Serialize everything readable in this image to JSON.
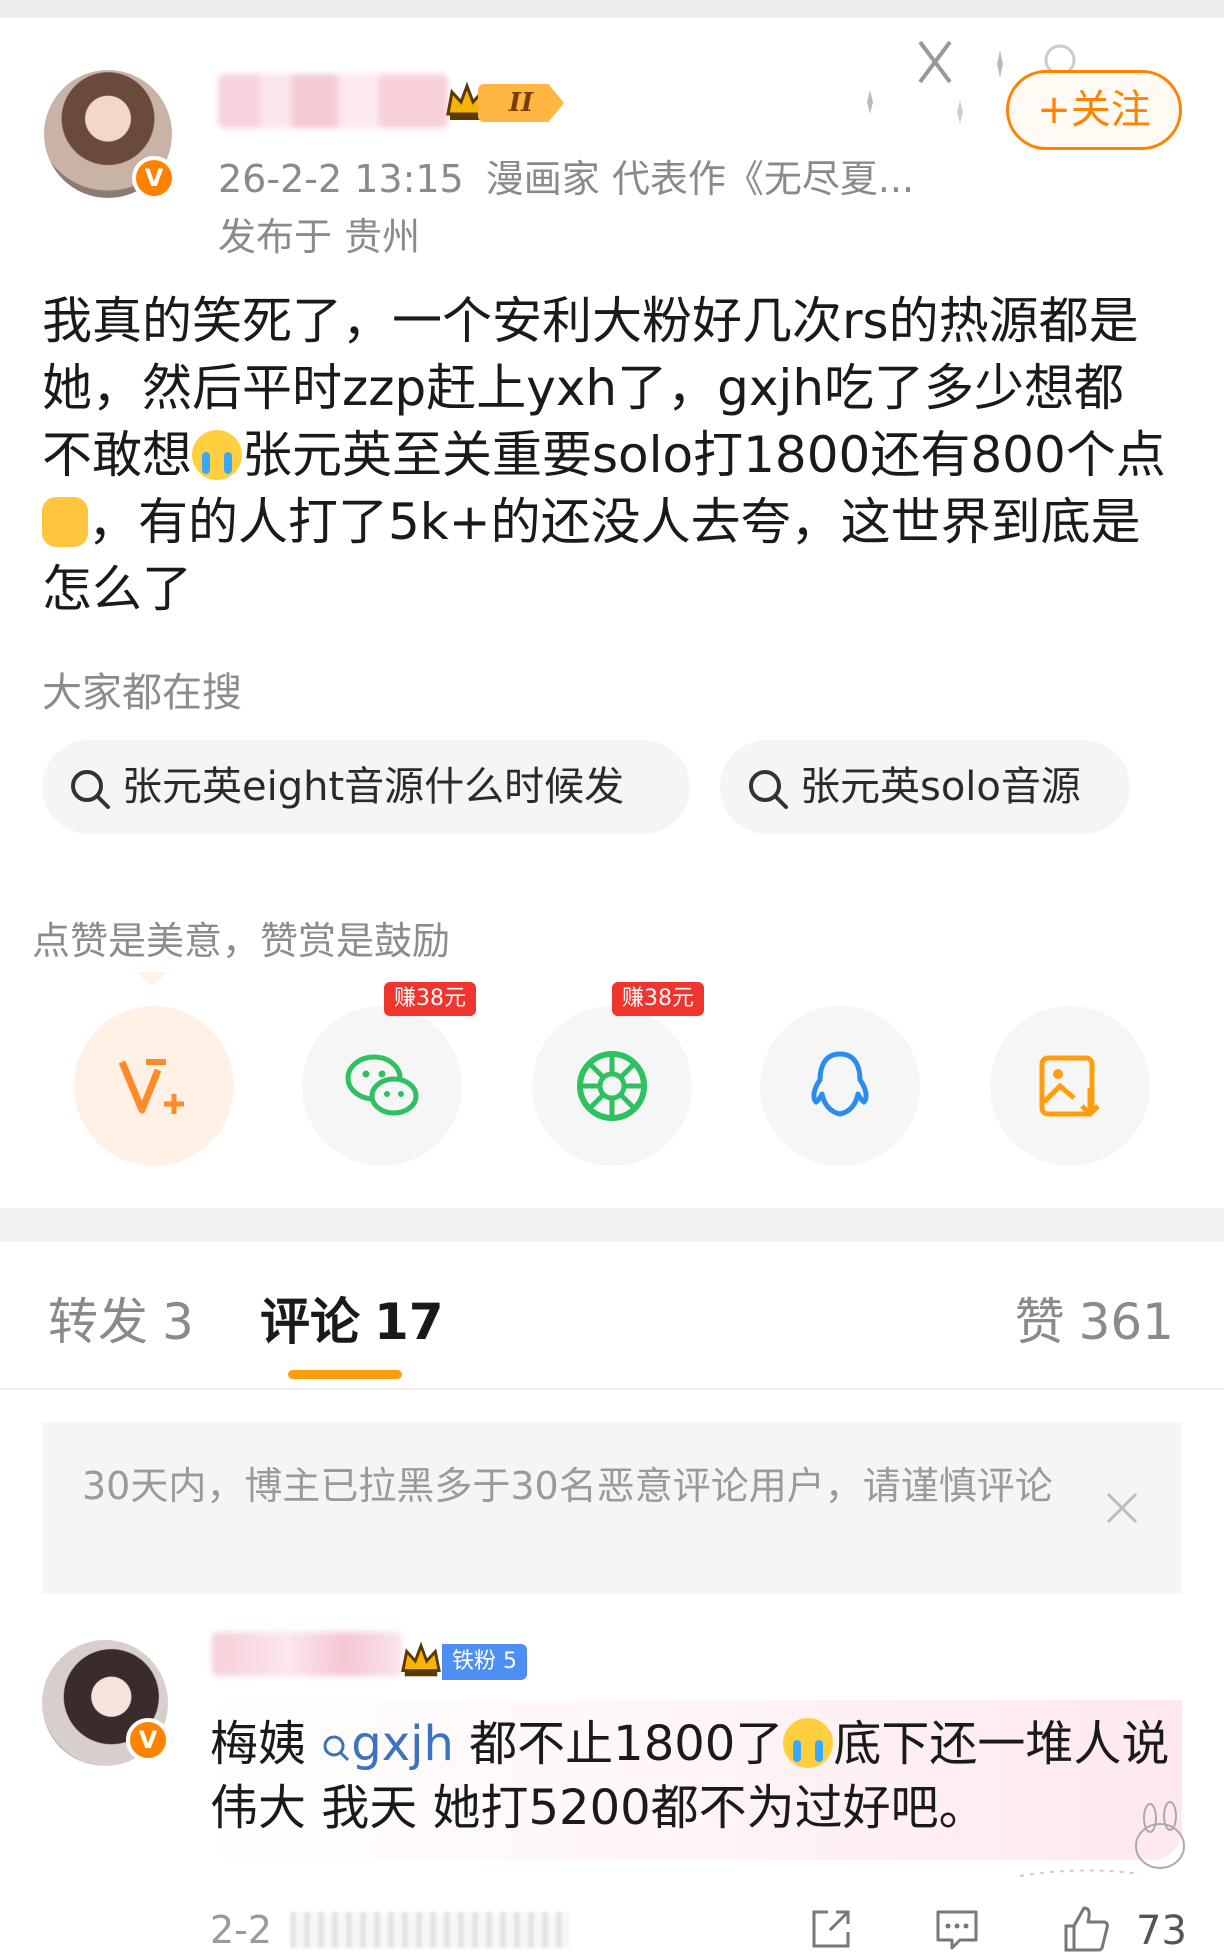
{
  "post": {
    "time": "26-2-2 13:15",
    "author_desc": "漫画家 代表作《无尽夏...",
    "location": "发布于 贵州",
    "follow_label": "+关注",
    "level_badge": "II",
    "text_1": "我真的笑死了，一个安利大粉好几次rs的热源都是她，然后平时zzp赶上yxh了，gxjh吃了多少想都不敢想",
    "text_2": "张元英至关重要solo打1800还有800个点",
    "text_3": "，有的人打了5k+的还没人去夸，这世界到底是怎么了"
  },
  "hot_search": {
    "label": "大家都在搜",
    "items": [
      "张元英eight音源什么时候发",
      "张元英solo音源"
    ]
  },
  "reward": {
    "hint": "点赞是美意，赞赏是鼓励",
    "earn_wechat": "赚38元",
    "earn_moments": "赚38元"
  },
  "tabs": {
    "forward_label": "转发",
    "forward_count": "3",
    "comment_label": "评论",
    "comment_count": "17",
    "like_label": "赞",
    "like_count": "361"
  },
  "notice": {
    "text": "30天内，博主已拉黑多于30名恶意评论用户，请谨慎评论"
  },
  "comment": {
    "fan_badge": "铁粉 5",
    "text_before": "梅姨",
    "mention": "gxjh",
    "text_mid": " 都不止1800了",
    "text_after": "底下还一堆人说伟大 我天 她打5200都不为过好吧。",
    "time": "2-2",
    "like_count": "73"
  },
  "colors": {
    "accent_orange": "#ff8200",
    "tab_underline": "#ff9e0d",
    "mention_blue": "#3c72bf",
    "earn_red": "#f0342e",
    "fan_blue": "#4d8ff2"
  },
  "icons": [
    "verified-v-icon",
    "crown-icon",
    "search-icon",
    "v-plus-icon",
    "wechat-icon",
    "moments-icon",
    "qq-icon",
    "save-image-icon",
    "close-icon",
    "share-icon",
    "comment-icon",
    "like-icon",
    "crying-emoji",
    "thumbs-up-emoji"
  ]
}
